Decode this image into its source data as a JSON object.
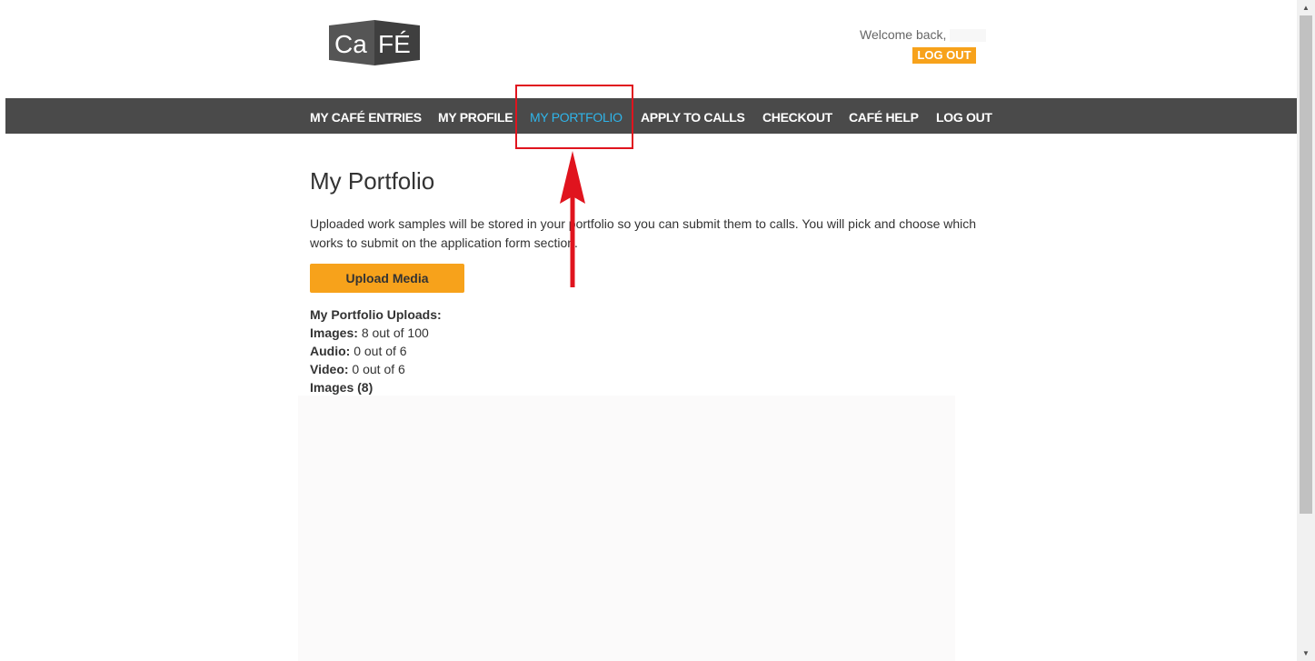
{
  "header": {
    "welcome_text": "Welcome back,",
    "logout_label": "LOG OUT"
  },
  "nav": {
    "items": [
      {
        "label": "MY CAFÉ ENTRIES"
      },
      {
        "label": "MY PROFILE"
      },
      {
        "label": "MY PORTFOLIO",
        "active": true
      },
      {
        "label": "APPLY TO CALLS"
      },
      {
        "label": "CHECKOUT"
      },
      {
        "label": "CAFÉ HELP"
      },
      {
        "label": "LOG OUT"
      }
    ]
  },
  "main": {
    "title": "My Portfolio",
    "intro": "Uploaded work samples will be stored in your portfolio so you can submit them to calls. You will pick and choose which works to submit on the application form section.",
    "upload_label": "Upload Media",
    "uploads_heading": "My Portfolio Uploads:",
    "stats": [
      {
        "label": "Images:",
        "value": "8 out of 100"
      },
      {
        "label": "Audio:",
        "value": "0 out of 6"
      },
      {
        "label": "Video:",
        "value": "0 out of 6"
      }
    ],
    "images_heading": "Images (8)"
  },
  "colors": {
    "accent": "#f7a21b",
    "nav_bg": "#4a4a4a",
    "nav_active": "#2fb5ea",
    "annotation": "#e0141e"
  },
  "icons": {
    "scroll_up": "▲",
    "scroll_down": "▼"
  }
}
